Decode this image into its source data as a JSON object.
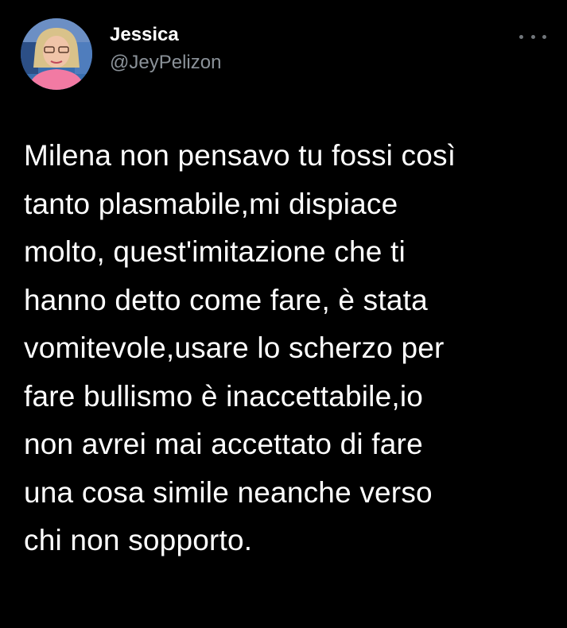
{
  "author": {
    "display_name": "Jessica",
    "handle": "@JeyPelizon",
    "avatar_icon": "profile-avatar"
  },
  "actions": {
    "more_icon": "more-horizontal-icon"
  },
  "tweet": {
    "text": "Milena non pensavo tu fossi così\ntanto plasmabile,mi dispiace\nmolto, quest'imitazione che ti\nhanno detto come fare, è stata\nvomitevole,usare lo scherzo per\nfare bullismo è inaccettabile,io\nnon avrei mai accettato di fare\nuna cosa simile neanche verso\nchi non sopporto."
  },
  "colors": {
    "background": "#000000",
    "text": "#ffffff",
    "secondary": "#8b9299"
  }
}
